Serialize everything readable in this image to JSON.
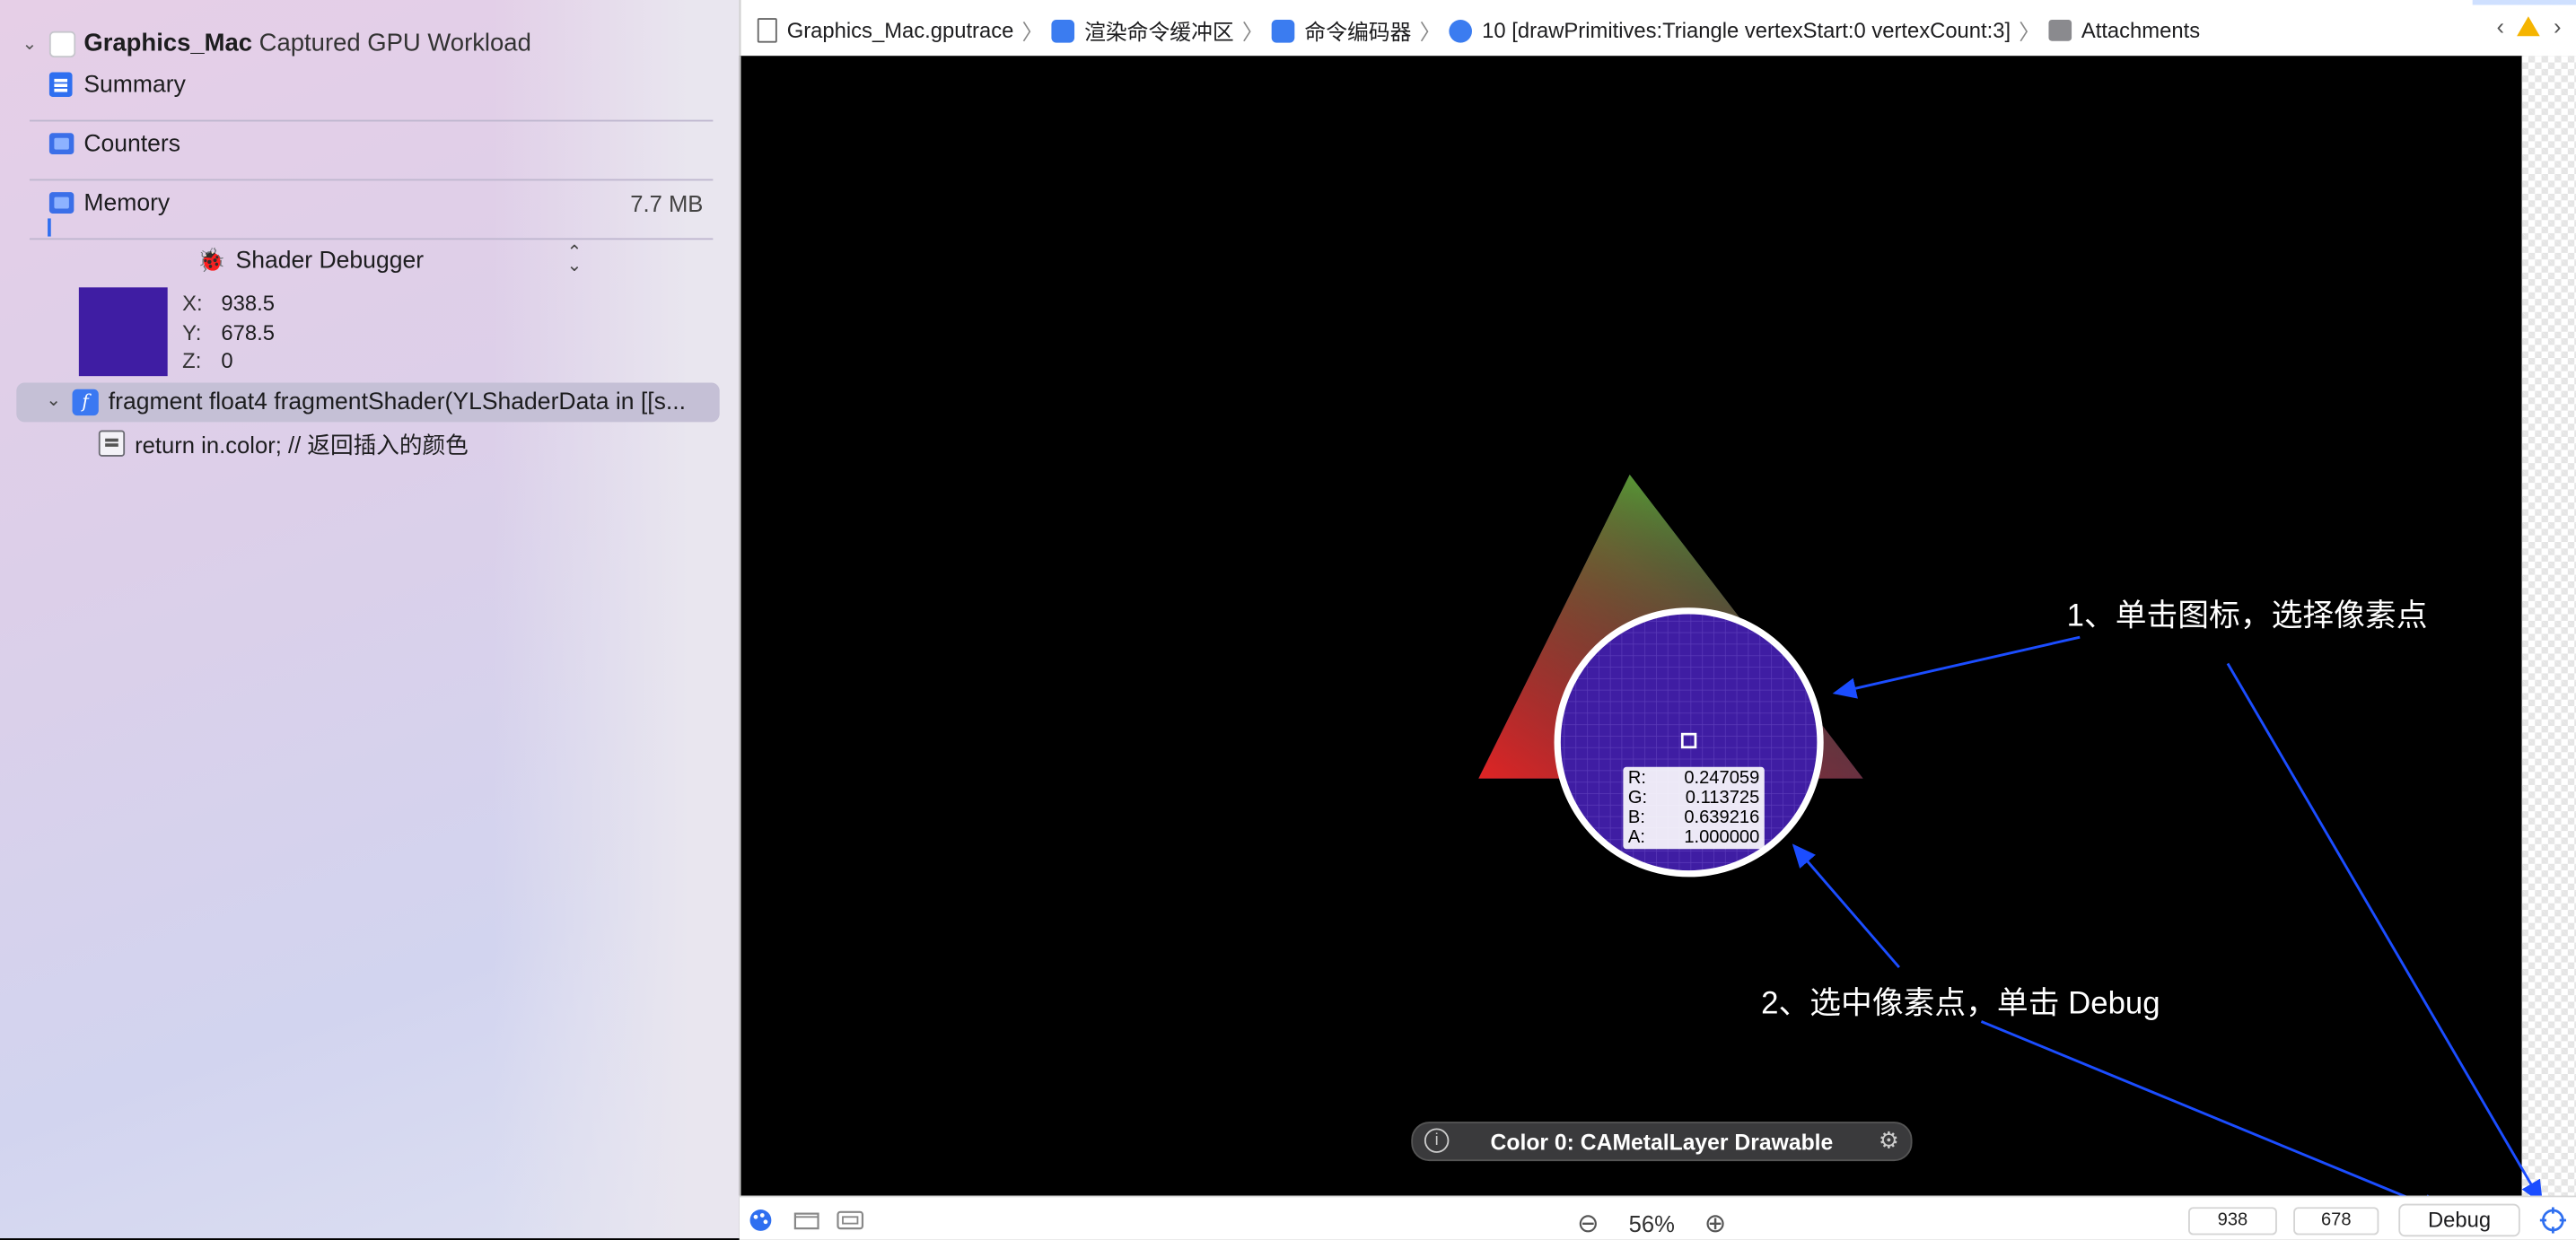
{
  "sidebar": {
    "root_title": "Graphics_Mac",
    "root_subtitle": "Captured GPU Workload",
    "items": [
      {
        "label": "Summary"
      },
      {
        "label": "Counters"
      },
      {
        "label": "Memory",
        "value": "7.7 MB"
      }
    ],
    "shader_debugger": {
      "label": "Shader Debugger",
      "coords": [
        {
          "axis": "X:",
          "value": "938.5"
        },
        {
          "axis": "Y:",
          "value": "678.5"
        },
        {
          "axis": "Z:",
          "value": "0"
        }
      ],
      "swatch_color": "#3f1da3",
      "function_signature": "fragment float4 fragmentShader(YLShaderData in [[s...",
      "statement": "return in.color; // 返回插入的颜色"
    }
  },
  "breadcrumb": [
    {
      "label": "Graphics_Mac.gputrace",
      "icon": "document-icon"
    },
    {
      "label": "渲染命令缓冲区",
      "icon": "command-buffer-icon"
    },
    {
      "label": "命令编码器",
      "icon": "command-encoder-icon"
    },
    {
      "label": "10 [drawPrimitives:Triangle vertexStart:0 vertexCount:3]",
      "icon": "draw-call-icon"
    },
    {
      "label": "Attachments",
      "icon": "attachments-icon"
    }
  ],
  "canvas": {
    "pixel_readout": [
      {
        "ch": "R:",
        "value": "0.247059"
      },
      {
        "ch": "G:",
        "value": "0.113725"
      },
      {
        "ch": "B:",
        "value": "0.639216"
      },
      {
        "ch": "A:",
        "value": "1.000000"
      }
    ],
    "annotation_1": "1、单击图标，选择像素点",
    "annotation_2": "2、选中像素点，单击 Debug",
    "attachment_label": "Color 0: CAMetalLayer Drawable",
    "colors": {
      "annotation_arrow": "#1b4dff",
      "loupe_fill": "#3f1da3"
    }
  },
  "bottom": {
    "zoom": "56%",
    "x_field": "938",
    "y_field": "678",
    "debug_label": "Debug"
  }
}
